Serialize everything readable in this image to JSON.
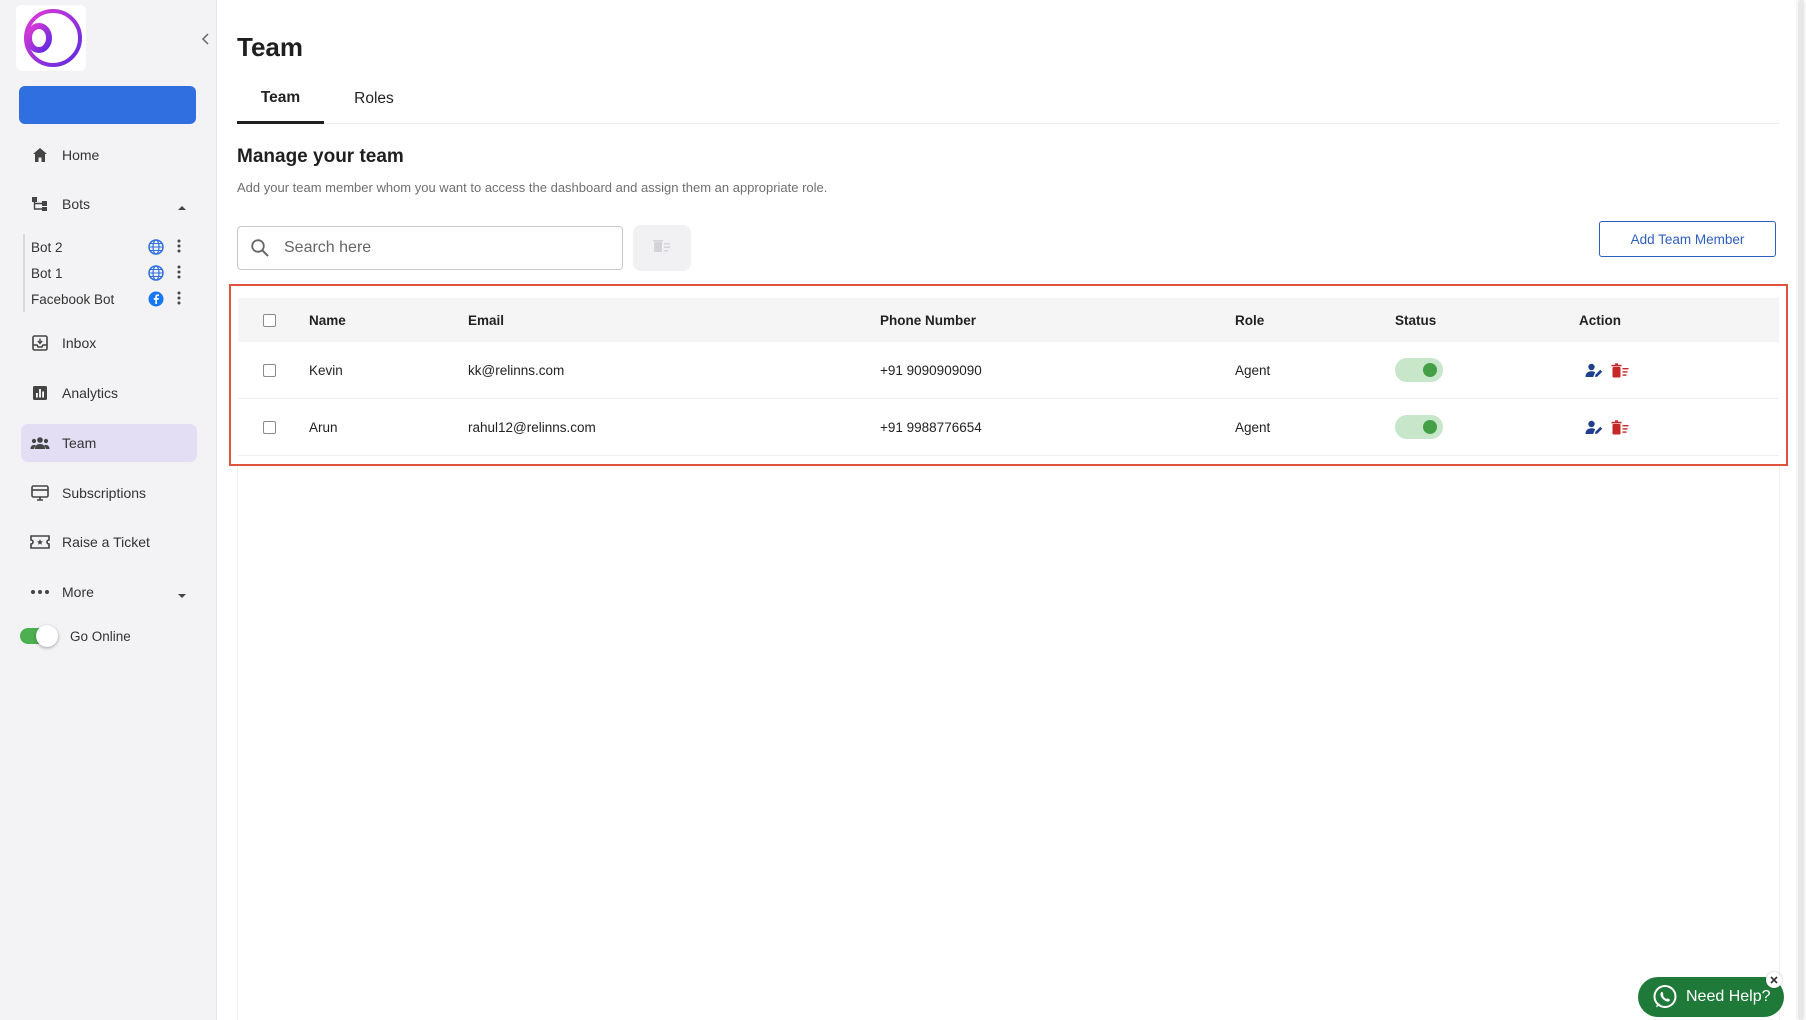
{
  "sidebar": {
    "home": "Home",
    "bots": "Bots",
    "bot_items": [
      {
        "label": "Bot 2",
        "channel_icon": "globe-icon"
      },
      {
        "label": "Bot 1",
        "channel_icon": "globe-icon"
      },
      {
        "label": "Facebook Bot",
        "channel_icon": "facebook-icon"
      }
    ],
    "inbox": "Inbox",
    "analytics": "Analytics",
    "team": "Team",
    "subscriptions": "Subscriptions",
    "raise_ticket": "Raise a Ticket",
    "more": "More",
    "go_online": "Go Online"
  },
  "header": {
    "title": "Team",
    "tabs": [
      {
        "label": "Team",
        "active": true
      },
      {
        "label": "Roles",
        "active": false
      }
    ]
  },
  "section": {
    "title": "Manage your team",
    "description": "Add your team member whom you want to access the dashboard and assign them an appropriate role."
  },
  "search": {
    "placeholder": "Search here",
    "value": ""
  },
  "add_member_label": "Add Team Member",
  "table": {
    "columns": [
      "Name",
      "Email",
      "Phone Number",
      "Role",
      "Status",
      "Action"
    ],
    "rows": [
      {
        "name": "Kevin",
        "email": "kk@relinns.com",
        "phone": "+91 9090909090",
        "role": "Agent",
        "status_on": true
      },
      {
        "name": "Arun",
        "email": "rahul12@relinns.com",
        "phone": "+91 9988776654",
        "role": "Agent",
        "status_on": true
      }
    ]
  },
  "help": {
    "label": "Need Help?"
  },
  "colors": {
    "accent": "#2f6fe0",
    "active_nav": "#e3def3",
    "highlight_border": "#e0533d",
    "toggle_on": "#43a047",
    "delete": "#c62828",
    "help_bg": "#1f7a3a"
  }
}
